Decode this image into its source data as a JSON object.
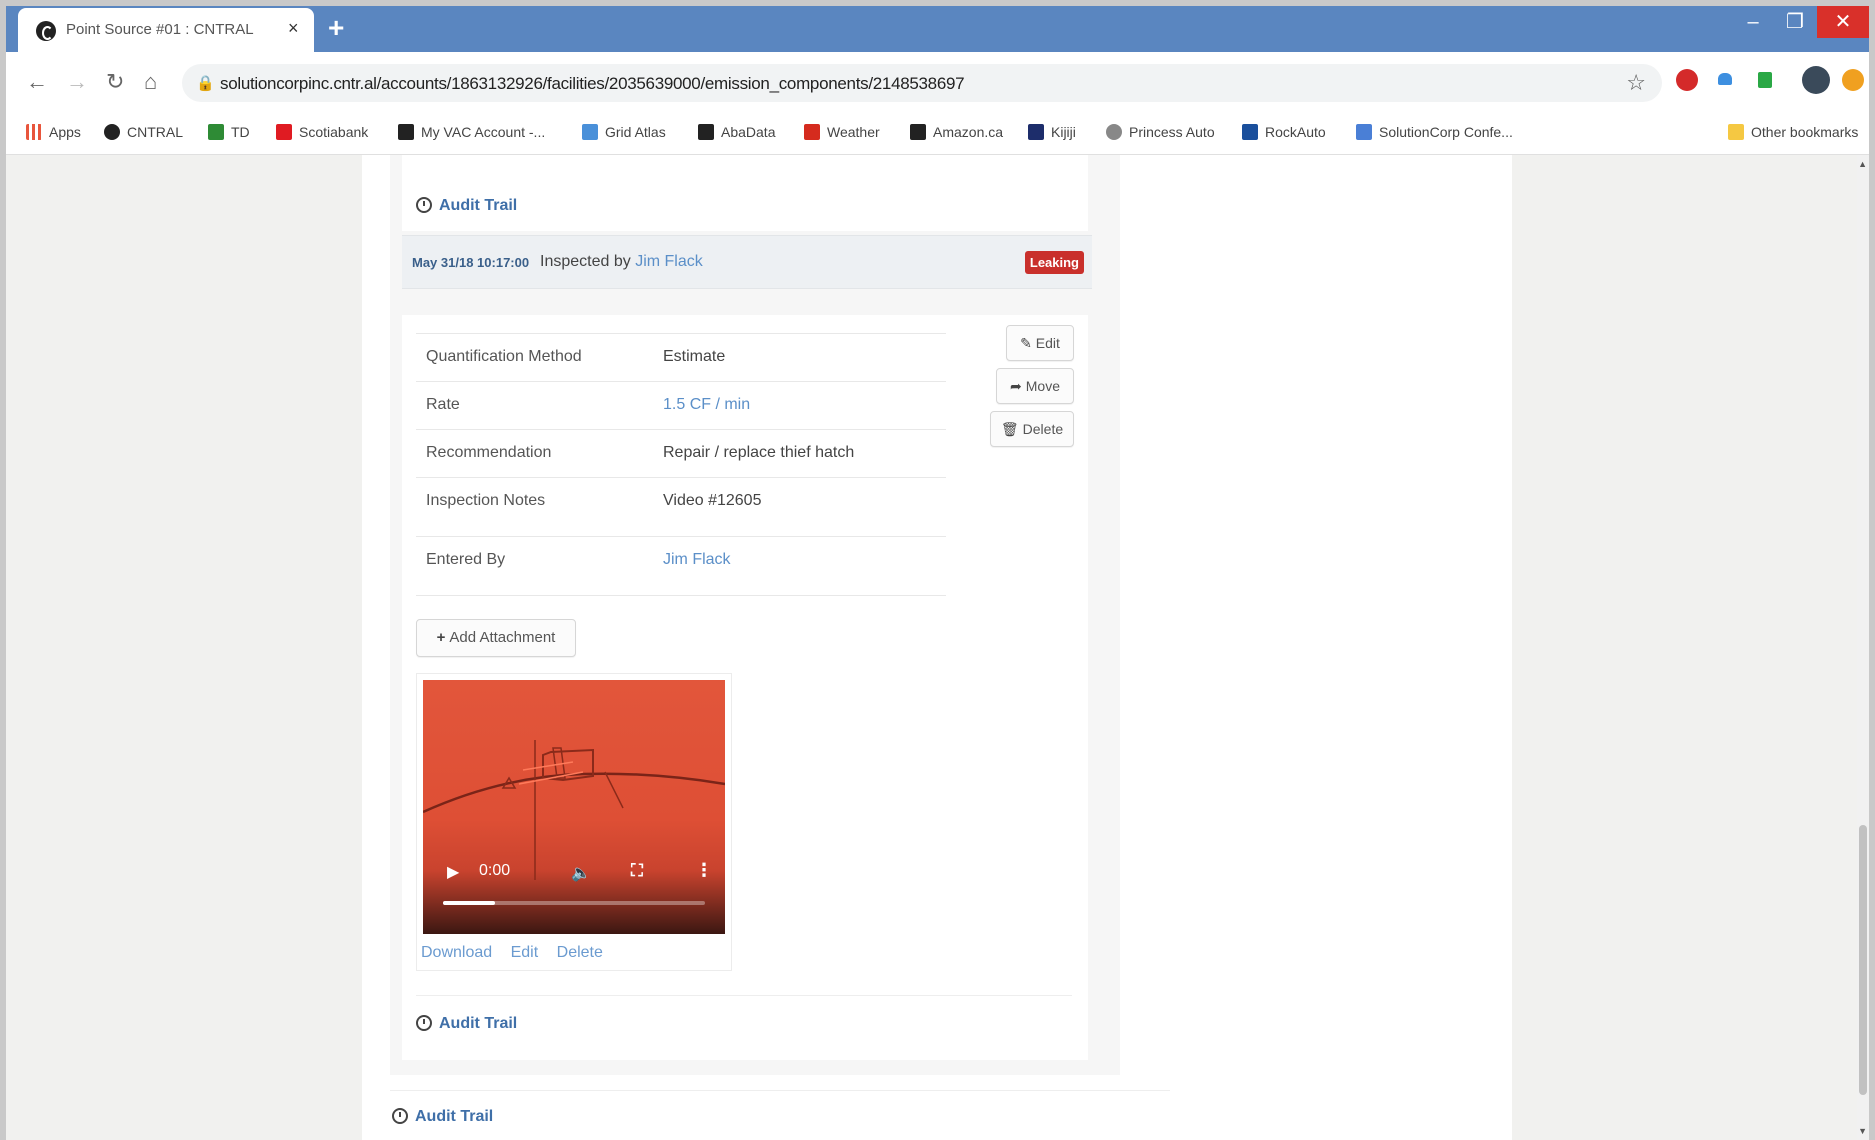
{
  "browser": {
    "tab_title": "Point Source #01 : CNTRAL",
    "tab_close": "×",
    "new_tab": "+",
    "window_controls": {
      "minimize": "–",
      "maximize": "❐",
      "close": "✕"
    },
    "nav": {
      "back": "←",
      "forward": "→",
      "reload": "↻",
      "home": "⌂"
    },
    "url": "solutioncorpinc.cntr.al/accounts/1863132926/facilities/2035639000/emission_components/2148538697",
    "bookmarks": [
      {
        "label": "Apps",
        "color": "#e8553c"
      },
      {
        "label": "CNTRAL",
        "color": "#222222"
      },
      {
        "label": "TD",
        "color": "#2e8b35"
      },
      {
        "label": "Scotiabank",
        "color": "#e01b22"
      },
      {
        "label": "My VAC Account -...",
        "color": "#222222"
      },
      {
        "label": "Grid Atlas",
        "color": "#4a90d9"
      },
      {
        "label": "AbaData",
        "color": "#222222"
      },
      {
        "label": "Weather",
        "color": "#d52b1e"
      },
      {
        "label": "Amazon.ca",
        "color": "#222222"
      },
      {
        "label": "Kijiji",
        "color": "#1d2d6b"
      },
      {
        "label": "Princess Auto",
        "color": "#888888"
      },
      {
        "label": "RockAuto",
        "color": "#1a4f9c"
      },
      {
        "label": "SolutionCorp Confe...",
        "color": "#4a7fd6"
      }
    ],
    "other_bookmarks": "Other bookmarks"
  },
  "page": {
    "audit_trail_label": "Audit Trail",
    "inspection": {
      "date": "May 31/18 10:17:00",
      "inspected_by_prefix": "Inspected by",
      "inspector": "Jim Flack",
      "status": "Leaking",
      "status_color": "#c9302c",
      "details": [
        {
          "label": "Quantification Method",
          "value": "Estimate",
          "link": false
        },
        {
          "label": "Rate",
          "value": "1.5 CF / min",
          "link": true
        },
        {
          "label": "Recommendation",
          "value": "Repair / replace thief hatch",
          "link": false
        },
        {
          "label": "Inspection Notes",
          "value": "Video #12605",
          "link": false
        },
        {
          "label": "Entered By",
          "value": "Jim Flack",
          "link": true
        }
      ],
      "actions": {
        "edit": "Edit",
        "move": "Move",
        "delete": "Delete"
      },
      "add_attachment": "Add Attachment",
      "attachment": {
        "video_time": "0:00",
        "progress": 0.2,
        "links": {
          "download": "Download",
          "edit": "Edit",
          "delete": "Delete"
        }
      }
    }
  }
}
